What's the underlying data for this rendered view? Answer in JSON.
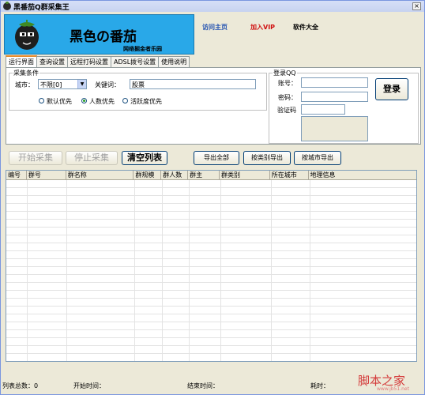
{
  "window": {
    "title": "黑番茄Q群采集王",
    "close": "×"
  },
  "banner": {
    "title": "黑色の番茄",
    "subtitle": "网络掘金者乐园"
  },
  "links": {
    "home": "访问主页",
    "vip": "加入VIP",
    "software": "软件大全"
  },
  "tabs": [
    {
      "label": "运行界面",
      "active": true
    },
    {
      "label": "查询设置",
      "active": false
    },
    {
      "label": "远程打码设置",
      "active": false
    },
    {
      "label": "ADSL拨号设置",
      "active": false
    },
    {
      "label": "使用说明",
      "active": false
    }
  ],
  "collect": {
    "group_label": "采集条件",
    "city_label": "城市：",
    "city_value": "不限[0]",
    "keyword_label": "关键词：",
    "keyword_value": "股票",
    "radios": [
      {
        "label": "默认优先",
        "checked": false
      },
      {
        "label": "人数优先",
        "checked": true
      },
      {
        "label": "活跃度优先",
        "checked": false
      }
    ]
  },
  "login": {
    "group_label": "登录QQ",
    "account_label": "账号：",
    "password_label": "密码：",
    "captcha_label": "验证码",
    "login_button": "登录"
  },
  "actions": {
    "start": "开始采集",
    "stop": "停止采集",
    "clear": "清空列表",
    "export_all": "导出全部",
    "export_category": "按类别导出",
    "export_city": "按城市导出"
  },
  "table": {
    "columns": [
      "编号",
      "群号",
      "群名称",
      "群规模",
      "群人数",
      "群主",
      "群类别",
      "所在城市",
      "地理信息"
    ]
  },
  "status": {
    "total": "列表总数：0",
    "start_time": "开始时间：",
    "end_time": "结束时间：",
    "elapsed": "耗时："
  },
  "watermark": {
    "text": "脚本之家",
    "url": "www.jb51.net"
  }
}
